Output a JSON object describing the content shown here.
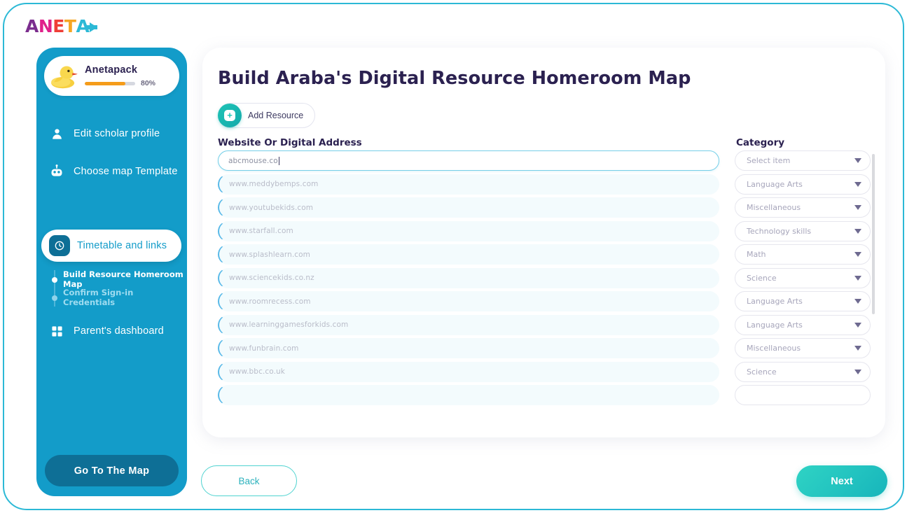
{
  "brand": {
    "logo_letters": [
      "A",
      "N",
      "E",
      "T",
      "A"
    ],
    "logo_text": "ANETA",
    "accent_cyan": "#2cb9d6",
    "accent_teal": "#22c3c0",
    "sidebar_blue": "#139cc9",
    "deep_blue": "#0e6f96",
    "title_ink": "#2b2150",
    "progress_orange": "#f59c1a"
  },
  "sidebar": {
    "profile": {
      "name": "Anetapack",
      "progress_percent": 80,
      "progress_label": "80%",
      "avatar_icon": "rubber-duck-icon"
    },
    "items": [
      {
        "label": "Edit scholar profile",
        "icon": "user-icon",
        "active": false
      },
      {
        "label": "Choose map Template",
        "icon": "robot-icon",
        "active": false
      },
      {
        "label": "Timetable and links",
        "icon": "clock-icon",
        "active": true
      },
      {
        "label": "Parent's dashboard",
        "icon": "grid-icon",
        "active": false
      }
    ],
    "sub_items": [
      {
        "label": "Build Resource Homeroom Map",
        "current": true
      },
      {
        "label": "Confirm Sign-in Credentials",
        "current": false
      }
    ],
    "go_to_map_label": "Go To The Map"
  },
  "main": {
    "title": "Build Araba's Digital Resource Homeroom Map",
    "add_resource_label": "Add Resource",
    "add_resource_icon": "plus-icon",
    "columns": {
      "url": "Website Or Digital Address",
      "category": "Category"
    },
    "delete_icon": "trash-icon",
    "dropdown_icon": "chevron-down-icon",
    "rows": [
      {
        "url": "abcmouse.co",
        "category": "Select item",
        "active": true,
        "filled": true
      },
      {
        "url": "www.meddybemps.com",
        "category": "Language Arts",
        "active": false,
        "filled": false
      },
      {
        "url": "www.youtubekids.com",
        "category": "Miscellaneous",
        "active": false,
        "filled": false
      },
      {
        "url": "www.starfall.com",
        "category": "Technology skills",
        "active": false,
        "filled": false
      },
      {
        "url": "www.splashlearn.com",
        "category": "Math",
        "active": false,
        "filled": false
      },
      {
        "url": "www.sciencekids.co.nz",
        "category": "Science",
        "active": false,
        "filled": false
      },
      {
        "url": "www.roomrecess.com",
        "category": "Language Arts",
        "active": false,
        "filled": false
      },
      {
        "url": "www.learninggamesforkids.com",
        "category": "Language Arts",
        "active": false,
        "filled": false
      },
      {
        "url": "www.funbrain.com",
        "category": "Miscellaneous",
        "active": false,
        "filled": false
      },
      {
        "url": "www.bbc.co.uk",
        "category": "Science",
        "active": false,
        "filled": false
      },
      {
        "url": "",
        "category": "",
        "active": false,
        "filled": false
      }
    ]
  },
  "footer": {
    "back_label": "Back",
    "next_label": "Next"
  }
}
